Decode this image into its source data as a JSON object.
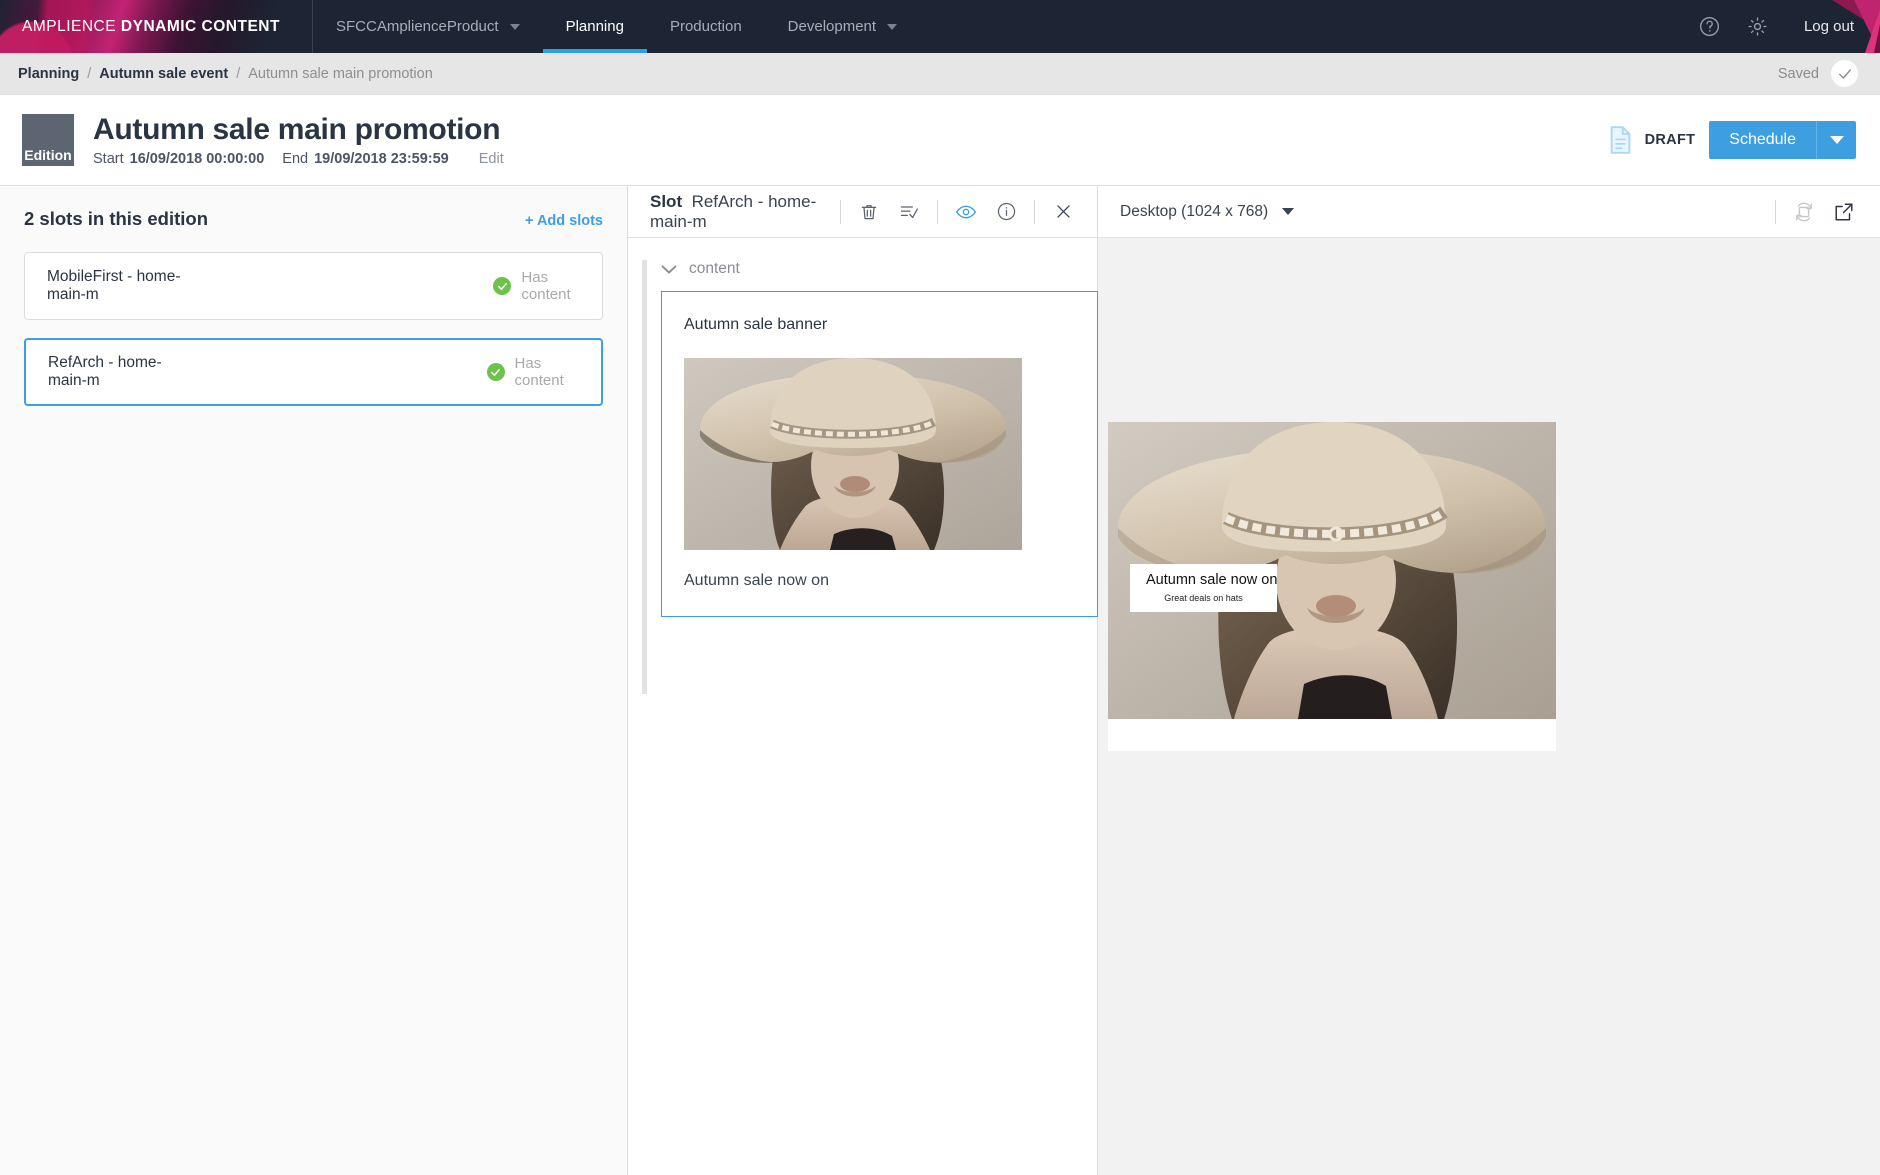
{
  "topnav": {
    "logo_light": "AMPLIENCE",
    "logo_bold": "DYNAMIC CONTENT",
    "project": "SFCCAmplienceProduct",
    "items": [
      {
        "label": "Planning",
        "active": true,
        "has_caret": false
      },
      {
        "label": "Production",
        "active": false,
        "has_caret": false
      },
      {
        "label": "Development",
        "active": false,
        "has_caret": true
      }
    ],
    "help_icon": "help-circle-icon",
    "settings_icon": "gear-icon",
    "logout_label": "Log out"
  },
  "breadcrumb": {
    "items": [
      {
        "label": "Planning",
        "style": "bold"
      },
      {
        "label": "Autumn sale event",
        "style": "bold"
      },
      {
        "label": "Autumn sale main promotion",
        "style": "muted"
      }
    ],
    "separator": "/",
    "saved_label": "Saved",
    "saved_icon": "check-icon"
  },
  "title": {
    "badge": "Edition",
    "heading": "Autumn sale main promotion",
    "start_label": "Start",
    "start_value": "16/09/2018 00:00:00",
    "end_label": "End",
    "end_value": "19/09/2018 23:59:59",
    "edit_label": "Edit",
    "status_label": "DRAFT",
    "status_icon": "document-icon",
    "schedule_label": "Schedule",
    "schedule_caret_icon": "chevron-down-icon",
    "accent_color": "#3e9fe0"
  },
  "slots_panel": {
    "count_label": "2 slots in this edition",
    "add_label": "+ Add slots",
    "slots": [
      {
        "name": "MobileFirst - home-main-m",
        "status": "Has content",
        "selected": false
      },
      {
        "name": "RefArch - home-main-m",
        "status": "Has content",
        "selected": true
      }
    ],
    "status_color": "#6cc24a"
  },
  "slot_panel": {
    "label": "Slot",
    "name": "RefArch - home-main-m",
    "tools": [
      {
        "icon": "trash-icon",
        "name": "delete-slot-button"
      },
      {
        "icon": "list-check-icon",
        "name": "slot-checklist-button"
      },
      {
        "icon": "eye-icon",
        "name": "preview-toggle-button",
        "active": true
      },
      {
        "icon": "info-circle-icon",
        "name": "slot-info-button"
      },
      {
        "icon": "close-icon",
        "name": "close-slot-button"
      }
    ],
    "content_group_label": "content",
    "content_group_icon": "chevron-down-icon",
    "card": {
      "heading": "Autumn sale banner",
      "caption": "Autumn sale now on",
      "image_alt": "woman-in-wide-brim-hat-photo"
    }
  },
  "preview_panel": {
    "device_label": "Desktop (1024 x 768)",
    "device_caret_icon": "chevron-down-icon",
    "rotate_icon": "rotate-device-icon",
    "open_external_icon": "open-external-icon",
    "banner": {
      "title": "Autumn sale now on",
      "subtitle": "Great deals on hats"
    }
  }
}
